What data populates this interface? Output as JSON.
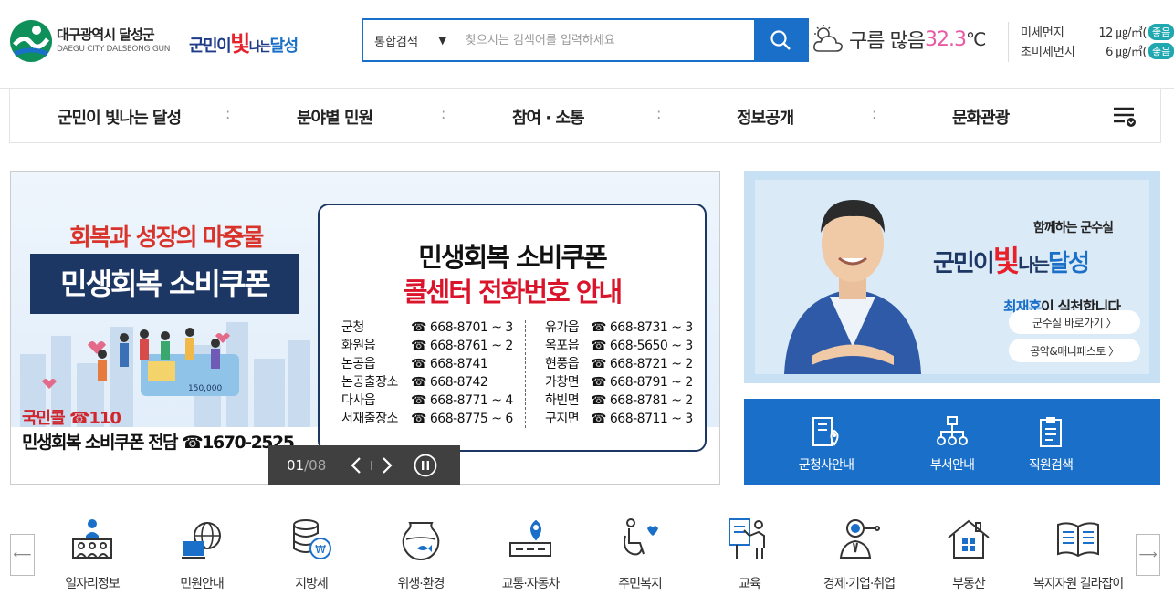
{
  "header": {
    "logo_ko": "대구광역시 달성군",
    "logo_en": "DAEGU CITY DALSEONG GUN",
    "slogan": {
      "a": "군민이",
      "b": "빛",
      "c": "나는",
      "d": "달성"
    },
    "search": {
      "category": "통합검색",
      "placeholder": "찾으시는 검색어를 입력하세요"
    },
    "weather": {
      "condition": "구름 많음",
      "temp": "32.3",
      "unit": "℃"
    },
    "dust": [
      {
        "label": "미세먼지",
        "value": "12 ㎍/㎥(",
        "grade": "좋음",
        "close": ")"
      },
      {
        "label": "초미세먼지",
        "value": "6 ㎍/㎥(",
        "grade": "좋음",
        "close": ")"
      }
    ]
  },
  "gnb": {
    "items": [
      "군민이 빛나는 달성",
      "분야별 민원",
      "참여 · 소통",
      "정보공개",
      "문화관광"
    ],
    "separator": ":"
  },
  "banner": {
    "headline_small": "회복과 성장의 마중물",
    "headline_big": "민생회복 소비쿠폰",
    "hotline1": "국민콜 ☎110",
    "hotline2": "민생회복 소비쿠폰 전담 ☎1670-2525",
    "illus_number": "150,000",
    "callbox_title1": "민생회복 소비쿠폰",
    "callbox_title2": "콜센터 전화번호 안내",
    "calls_left": [
      {
        "name": "군청",
        "tel": "☎ 668-8701 ~ 3"
      },
      {
        "name": "화원읍",
        "tel": "☎ 668-8761 ~ 2"
      },
      {
        "name": "논공읍",
        "tel": "☎ 668-8741"
      },
      {
        "name": "논공출장소",
        "tel": "☎ 668-8742"
      },
      {
        "name": "다사읍",
        "tel": "☎ 668-8771 ~ 4"
      },
      {
        "name": "서재출장소",
        "tel": "☎ 668-8775 ~ 6"
      }
    ],
    "calls_right": [
      {
        "name": "유가읍",
        "tel": "☎ 668-8731 ~ 3"
      },
      {
        "name": "옥포읍",
        "tel": "☎ 668-5650 ~ 3"
      },
      {
        "name": "현풍읍",
        "tel": "☎ 668-8721 ~ 2"
      },
      {
        "name": "가창면",
        "tel": "☎ 668-8791 ~ 2"
      },
      {
        "name": "하빈면",
        "tel": "☎ 668-8781 ~ 2"
      },
      {
        "name": "구지면",
        "tel": "☎ 668-8711 ~ 3"
      }
    ],
    "pager": {
      "current": "01",
      "total": "/08"
    }
  },
  "promo": {
    "small": "함께하는 군수실",
    "slogan": {
      "a": "군민이",
      "b": "빛",
      "c": "나는",
      "d": "달성"
    },
    "name_hl": "최재훈",
    "name_rest": "이 실천합니다",
    "btn1": "군수실 바로가기 〉",
    "btn2": "공약&매니페스토 〉"
  },
  "quick": [
    "군청사안내",
    "부서안내",
    "직원검색"
  ],
  "categories": [
    "일자리정보",
    "민원안내",
    "지방세",
    "위생·환경",
    "교통·자동차",
    "주민복지",
    "교육",
    "경제·기업·취업",
    "부동산",
    "복지자원 길라잡이"
  ],
  "colors": {
    "primary": "#1a6fc9",
    "navy": "#1d3764",
    "red": "#d9142b",
    "temp": "#e85aa4"
  }
}
